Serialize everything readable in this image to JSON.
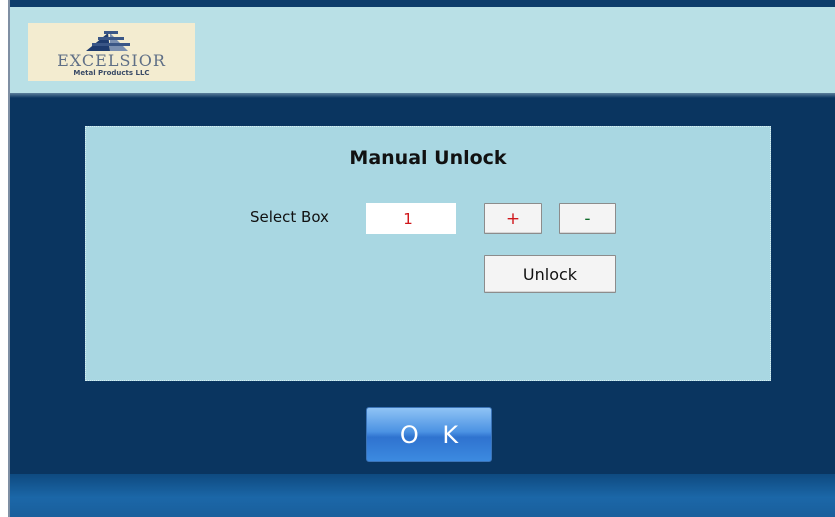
{
  "logo": {
    "word": "EXCELSIOR",
    "subtitle": "Metal Products LLC"
  },
  "panel": {
    "title": "Manual Unlock",
    "select_label": "Select Box",
    "box_value": "1",
    "plus_label": "+",
    "minus_label": "-",
    "unlock_label": "Unlock"
  },
  "dialog": {
    "ok_label": "O K"
  },
  "colors": {
    "frame_bg": "#0a3560",
    "header_bg": "#b9e0e6",
    "panel_bg": "#a9d7e2",
    "value_text": "#d0161a",
    "plus_text": "#d0161a",
    "minus_text": "#0f6b2a",
    "ok_button": "#3c8ae0"
  }
}
